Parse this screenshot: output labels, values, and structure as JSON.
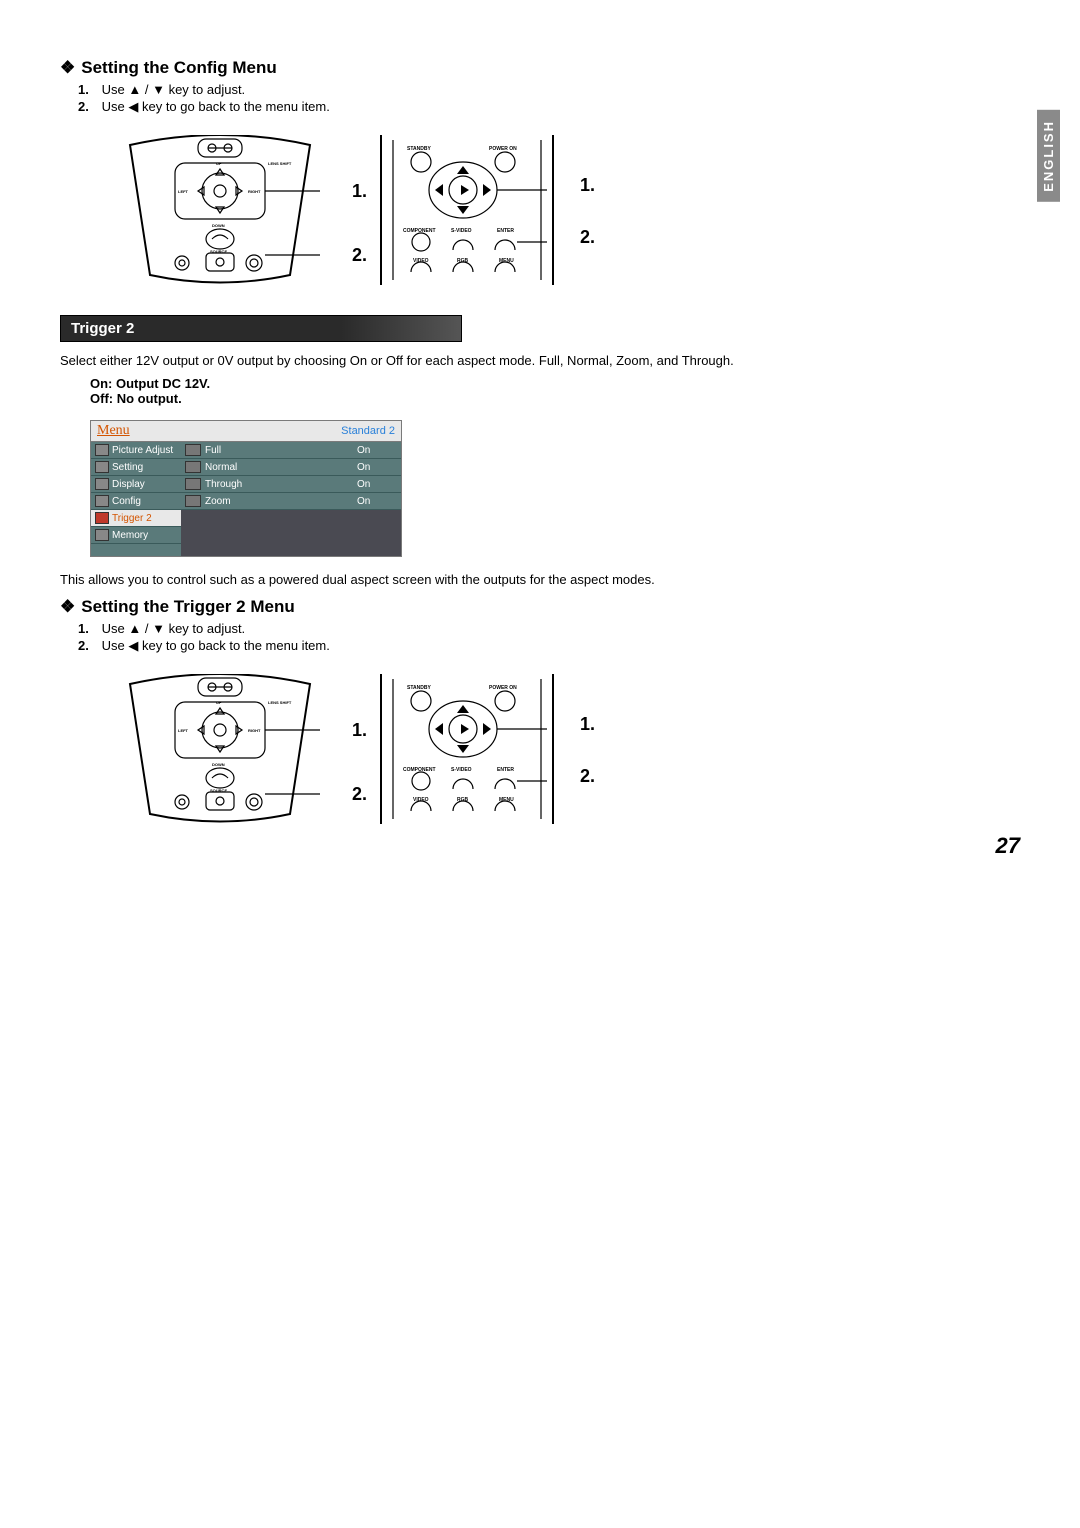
{
  "language_tab": "ENGLISH",
  "heading1": "Setting the Config Menu",
  "heading2": "Setting the Trigger 2 Menu",
  "step1_prefix": "Use ",
  "step1_suffix": " key to adjust.",
  "step2_prefix": "Use ",
  "step2_suffix": " key to go back to the menu item.",
  "step1_num": "1.",
  "step2_num": "2.",
  "trigger2_bar": "Trigger 2",
  "trigger2_desc": "Select either 12V output or 0V output by choosing On or Off for each aspect mode. Full, Normal, Zoom, and Through.",
  "trigger2_on": "On:   Output DC 12V.",
  "trigger2_off": "Off:   No output.",
  "trigger2_note": "This allows you to control such as a powered dual aspect screen with the outputs for the aspect modes.",
  "osd": {
    "title": "Menu",
    "standard": "Standard 2",
    "left": [
      "Picture Adjust",
      "Setting",
      "Display",
      "Config",
      "Trigger 2",
      "Memory"
    ],
    "rows": [
      {
        "label": "Full",
        "val": "On"
      },
      {
        "label": "Normal",
        "val": "On"
      },
      {
        "label": "Through",
        "val": "On"
      },
      {
        "label": "Zoom",
        "val": "On"
      }
    ]
  },
  "device_labels": {
    "up": "UP",
    "down": "DOWN",
    "left": "LEFT",
    "right": "RIGHT",
    "lens_shift": "LENS SHIFT",
    "source": "SOURCE"
  },
  "remote_labels": {
    "standby": "STANDBY",
    "poweron": "POWER ON",
    "component": "COMPONENT",
    "svideo": "S-VIDEO",
    "enter": "ENTER",
    "video": "VIDEO",
    "rgb": "RGB",
    "menu": "MENU"
  },
  "callout1": "1.",
  "callout2": "2.",
  "page_number": "27",
  "slash": " / "
}
